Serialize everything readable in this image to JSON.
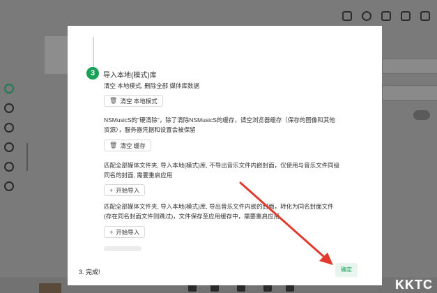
{
  "modal": {
    "step_number": "3",
    "step_title": "导入本地(模式)库",
    "section1_text": "清空 本地模式, 删除全部 媒体库数据",
    "clear_local_label": "清空 本地模式",
    "section2_line1": "NSMusicS的\"硬清除\"，除了清除NSMusicS的缓存，请空浏览器缓存（保存的图像和其他",
    "section2_line2": "资源），服务器凭据和设置会被保留",
    "clear_cache_label": "清空 缓存",
    "section3_line1": "匹配全部媒体文件夹, 导入本地(模式)库, 不导出音乐文件内嵌封面，仅使用与音乐文件同级",
    "section3_line2": "同名的封面, 需要重启应用",
    "start_import_label_1": "开始导入",
    "section4_line1": "匹配全部媒体文件夹, 导入本地(模式)库, 导出音乐文件内嵌的封面，转化为同名封面文件",
    "section4_line2": "(存在同名封面文件则跳过)，文件保存至应用缓存中，需要重启应用",
    "start_import_label_2": "开始导入",
    "done_text": "3. 完成!",
    "ok_label": "确定"
  },
  "watermark": "KKTC"
}
